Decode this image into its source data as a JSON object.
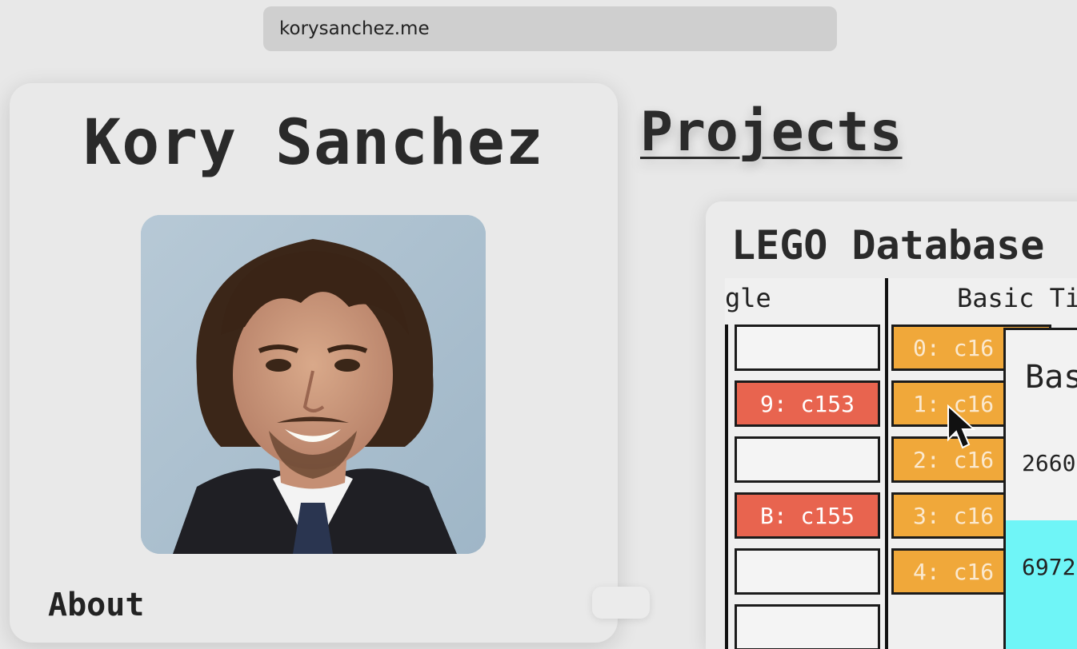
{
  "browser": {
    "url": "korysanchez.me"
  },
  "profile": {
    "name": "Kory Sanchez",
    "about_heading": "About"
  },
  "projects": {
    "heading": "Projects",
    "card": {
      "title": "LEGO Database",
      "preview": {
        "columns": [
          "gle",
          "Basic Ti"
        ],
        "left_cells": [
          "",
          "9: c153",
          "",
          "B: c155",
          "",
          ""
        ],
        "right_cells": [
          "0: c16",
          "1: c16",
          "2: c16",
          "3: c16",
          "4: c16"
        ],
        "popup": {
          "title": "Bas",
          "rows": [
            "2660",
            "6972"
          ]
        }
      }
    }
  },
  "colors": {
    "page_bg": "#e8e8e8",
    "cell_red": "#e8644f",
    "cell_orange": "#f0a83a",
    "popup_highlight": "#6ff5f7"
  }
}
